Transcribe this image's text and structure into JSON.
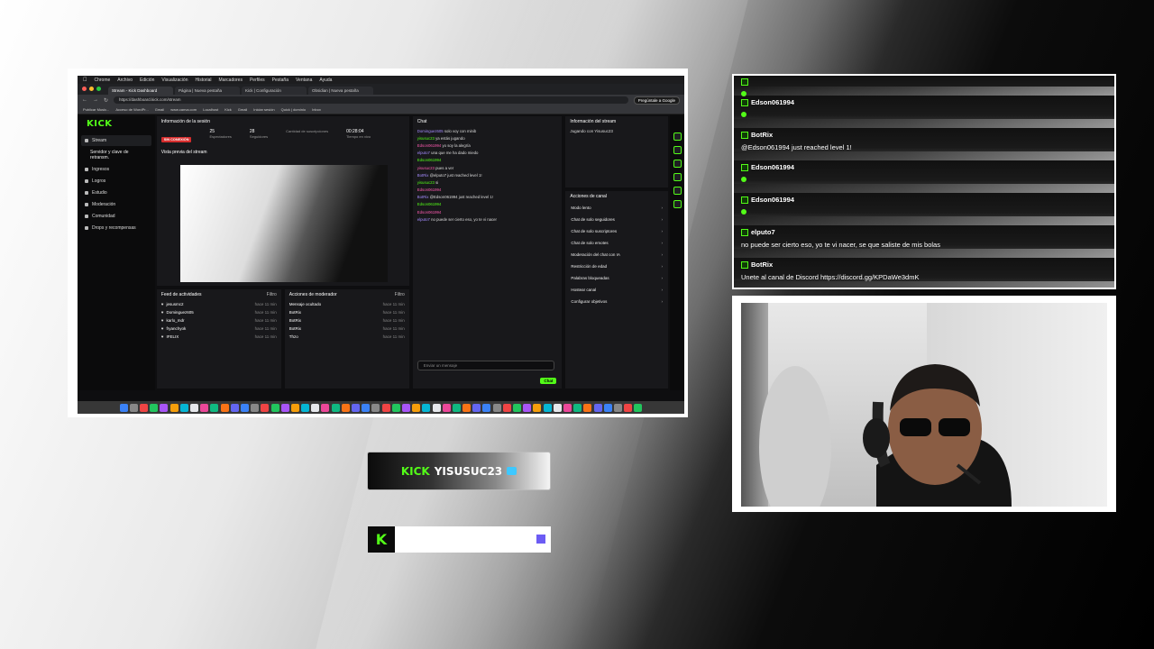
{
  "colors": {
    "kick_green": "#53fc18",
    "live_red": "#d62e2e",
    "accent_purple": "#6c5cf4"
  },
  "mac_menu": [
    "Chrome",
    "Archivo",
    "Edición",
    "Visualización",
    "Historial",
    "Marcadores",
    "Perfiles",
    "Pestaña",
    "Ventana",
    "Ayuda"
  ],
  "browser": {
    "tabs": [
      "Stream - Kick Dashboard",
      "Página | Nueva pestaña",
      "Kick | Configuración",
      "Obsidian | Nueva pestaña"
    ],
    "url": "https://dashboard.kick.com/stream",
    "google_button": "Pregúntale a Google",
    "bookmarks": [
      "Publicar Music...",
      "Acceso de WordPr...",
      "Gmail",
      "www.canva.com",
      "Localhost",
      "Kick",
      "Gmail",
      "Iniciar sesión",
      "Quick | dominio",
      "Inbox"
    ]
  },
  "kick": {
    "logo": "KICK",
    "nav": [
      {
        "label": "Stream",
        "selected": true,
        "sub": false
      },
      {
        "label": "Servidor y clave de retransm.",
        "selected": false,
        "sub": true
      },
      {
        "label": "Ingresos",
        "selected": false,
        "sub": false
      },
      {
        "label": "Logros",
        "selected": false,
        "sub": false
      },
      {
        "label": "Estudio",
        "selected": false,
        "sub": false
      },
      {
        "label": "Moderación",
        "selected": false,
        "sub": false
      },
      {
        "label": "Comunidad",
        "selected": false,
        "sub": false
      },
      {
        "label": "Drops y recompensas",
        "selected": false,
        "sub": false
      }
    ],
    "session": {
      "title": "Información de la sesión",
      "badge": "SIN CONEXIÓN",
      "stats": [
        {
          "value": "25",
          "label": "Espectadores"
        },
        {
          "value": "28",
          "label": "Seguidores"
        },
        {
          "value": "",
          "label": "Cantidad de suscripciones"
        },
        {
          "value": "00:28:04",
          "label": "Tiempo en vivo"
        }
      ],
      "preview_title": "Vista previa del stream"
    },
    "activity": {
      "title": "Feed de actividades",
      "filter": "Filtro",
      "items": [
        {
          "name": "jesusmc2",
          "time": "hace 11 min"
        },
        {
          "name": "Dominguez605",
          "time": "hace 11 min"
        },
        {
          "name": "karlo_mdr",
          "time": "hace 11 min"
        },
        {
          "name": "fryanchyok",
          "time": "hace 11 min"
        },
        {
          "name": "IFELIX",
          "time": "hace 11 min"
        }
      ]
    },
    "modactions": {
      "title": "Acciones de moderador",
      "filter": "Filtro",
      "items": [
        {
          "name": "Mensaje ocultado",
          "time": "hace 11 min"
        },
        {
          "name": "BotRix",
          "time": "hace 11 min"
        },
        {
          "name": "BotRix",
          "time": "hace 11 min"
        },
        {
          "name": "BotRix",
          "time": "hace 11 min"
        },
        {
          "name": "Thzo",
          "time": "hace 11 min"
        }
      ]
    },
    "chat": {
      "title": "Chat",
      "lines": [
        {
          "user": "Dominguez605",
          "text": "solo voy con minib"
        },
        {
          "user": "yisusuc23",
          "text": "ya estás jugando"
        },
        {
          "user": "Edson061994",
          "text": "yo soy la alegría"
        },
        {
          "user": "elputo7",
          "text": "una que me ha dado miedo"
        },
        {
          "user": "Edson061994",
          "text": ""
        },
        {
          "user": "yisusuc23",
          "text": "pues a ver"
        },
        {
          "user": "BotRix",
          "text": "@elputo7 just reached level 1!"
        },
        {
          "user": "yisusuc23",
          "text": "si"
        },
        {
          "user": "Edson061994",
          "text": ""
        },
        {
          "user": "BotRix",
          "text": "@Edson061994 just reached level 1!"
        },
        {
          "user": "Edson061994",
          "text": ""
        },
        {
          "user": "Edson061994",
          "text": ""
        },
        {
          "user": "elputo7",
          "text": "no puede ser cierto eso, yo te vi nacer"
        }
      ],
      "placeholder": "Enviar un mensaje",
      "send": "Chat"
    },
    "streaminfo": {
      "title": "Información del stream",
      "subtitle": "Jugando con Yisusuc23"
    },
    "channel": {
      "title": "Acciones de canal",
      "options": [
        "Modo lento",
        "Chat de solo seguidores",
        "Chat de solo suscriptores",
        "Chat de solo emotes",
        "Moderación del chat con IA",
        "Restricción de edad",
        "Palabras bloqueadas",
        "Hostear canal",
        "Configurar objetivos"
      ]
    }
  },
  "chat_overlay": {
    "messages": [
      {
        "user": "",
        "text": "",
        "emote": true
      },
      {
        "user": "Edson061994",
        "text": "",
        "emote": true
      },
      {
        "user": "BotRix",
        "text": "@Edson061994 just reached level 1!",
        "emote": false
      },
      {
        "user": "Edson061994",
        "text": "",
        "emote": true
      },
      {
        "user": "Edson061994",
        "text": "",
        "emote": true
      },
      {
        "user": "elputo7",
        "text": "no puede ser cierto eso, yo te vi nacer, se que saliste de mis bolas",
        "emote": false
      },
      {
        "user": "BotRix",
        "text": "Unete al canal de Discord https://discord.gg/KPDaWe3dmK",
        "emote": false
      }
    ]
  },
  "namebar": {
    "kick": "KICK",
    "name": "YISUSUC23"
  },
  "kickbar": {
    "logo": "K"
  }
}
